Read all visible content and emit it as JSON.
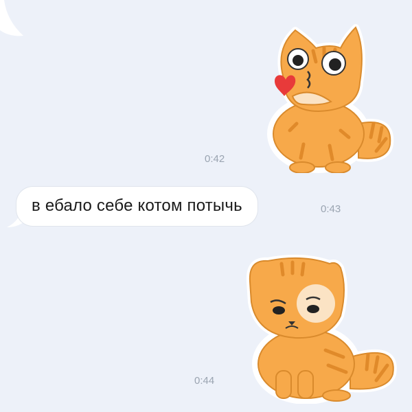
{
  "messages": [
    {
      "type": "sticker",
      "sticker": "cat-blowing-kiss-sticker",
      "time": "0:42"
    },
    {
      "type": "text",
      "text": "в ебало себе котом потычь",
      "time": "0:43"
    },
    {
      "type": "sticker",
      "sticker": "sad-cat-sticker",
      "time": "0:44"
    }
  ],
  "colors": {
    "background": "#edf1f9",
    "bubble": "#ffffff",
    "time": "#9aa4b1",
    "cat_fur": "#f7a94a",
    "cat_stripes": "#e08a2a",
    "heart": "#e83a3a"
  }
}
